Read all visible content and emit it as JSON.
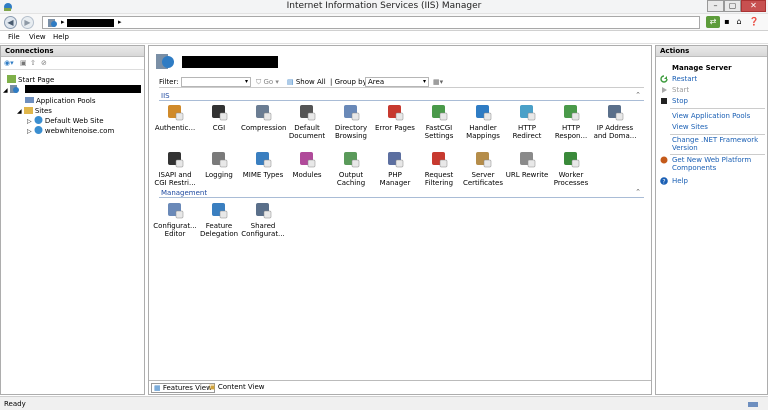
{
  "window": {
    "title": "Internet Information Services (IIS) Manager"
  },
  "menu": [
    "File",
    "View",
    "Help"
  ],
  "connections": {
    "title": "Connections",
    "tree": {
      "start_page": "Start Page",
      "app_pools": "Application Pools",
      "sites": "Sites",
      "site1": "Default Web Site",
      "site2": "webwhitenoise.com"
    }
  },
  "filter": {
    "label": "Filter:",
    "go": "Go",
    "show_all": "Show All",
    "group_by": "Group by:",
    "group_value": "Area"
  },
  "sections": {
    "iis": "IIS",
    "management": "Management"
  },
  "features": [
    {
      "l1": "Authentic...",
      "l2": ""
    },
    {
      "l1": "CGI",
      "l2": ""
    },
    {
      "l1": "Compression",
      "l2": ""
    },
    {
      "l1": "Default",
      "l2": "Document"
    },
    {
      "l1": "Directory",
      "l2": "Browsing"
    },
    {
      "l1": "Error Pages",
      "l2": ""
    },
    {
      "l1": "FastCGI",
      "l2": "Settings"
    },
    {
      "l1": "Handler",
      "l2": "Mappings"
    },
    {
      "l1": "HTTP",
      "l2": "Redirect"
    },
    {
      "l1": "HTTP",
      "l2": "Respon..."
    },
    {
      "l1": "IP Address",
      "l2": "and Doma..."
    },
    {
      "l1": "ISAPI and",
      "l2": "CGI Restri..."
    },
    {
      "l1": "Logging",
      "l2": ""
    },
    {
      "l1": "MIME Types",
      "l2": ""
    },
    {
      "l1": "Modules",
      "l2": ""
    },
    {
      "l1": "Output",
      "l2": "Caching"
    },
    {
      "l1": "PHP",
      "l2": "Manager"
    },
    {
      "l1": "Request",
      "l2": "Filtering"
    },
    {
      "l1": "Server",
      "l2": "Certificates"
    },
    {
      "l1": "URL Rewrite",
      "l2": ""
    },
    {
      "l1": "Worker",
      "l2": "Processes"
    }
  ],
  "management": [
    {
      "l1": "Configurat...",
      "l2": "Editor"
    },
    {
      "l1": "Feature",
      "l2": "Delegation"
    },
    {
      "l1": "Shared",
      "l2": "Configurat..."
    }
  ],
  "footer": {
    "features_view": "Features View",
    "content_view": "Content View"
  },
  "actions": {
    "title": "Actions",
    "manage_server": "Manage Server",
    "restart": "Restart",
    "start": "Start",
    "stop": "Stop",
    "view_app_pools": "View Application Pools",
    "view_sites": "View Sites",
    "change_net_1": "Change .NET Framework",
    "change_net_2": "Version",
    "get_platform_1": "Get New Web Platform",
    "get_platform_2": "Components",
    "help": "Help"
  },
  "status": {
    "text": "Ready"
  }
}
